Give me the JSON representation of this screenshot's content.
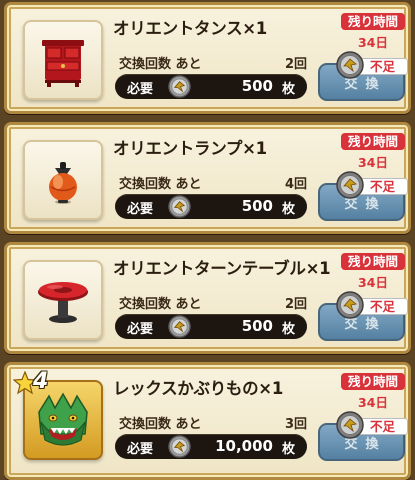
{
  "items": [
    {
      "name": "オリエントタンス×1",
      "icon": "red-cabinet-icon",
      "exchange_label": "交換回数 あと",
      "exchange_count": "2回",
      "cost_label": "必要",
      "cost_value": "500",
      "cost_unit": "枚",
      "time_label": "残り時間",
      "time_value": "34日",
      "shortage_label": "不足",
      "button_label": "交換",
      "rarity": ""
    },
    {
      "name": "オリエントランプ×1",
      "icon": "orient-lamp-icon",
      "exchange_label": "交換回数 あと",
      "exchange_count": "4回",
      "cost_label": "必要",
      "cost_value": "500",
      "cost_unit": "枚",
      "time_label": "残り時間",
      "time_value": "34日",
      "shortage_label": "不足",
      "button_label": "交換",
      "rarity": ""
    },
    {
      "name": "オリエントターンテーブル×1",
      "icon": "red-turntable-icon",
      "exchange_label": "交換回数 あと",
      "exchange_count": "2回",
      "cost_label": "必要",
      "cost_value": "500",
      "cost_unit": "枚",
      "time_label": "残り時間",
      "time_value": "34日",
      "shortage_label": "不足",
      "button_label": "交換",
      "rarity": ""
    },
    {
      "name": "レックスかぶりもの×1",
      "icon": "dragon-headgear-icon",
      "exchange_label": "交換回数 あと",
      "exchange_count": "3回",
      "cost_label": "必要",
      "cost_value": "10,000",
      "cost_unit": "枚",
      "time_label": "残り時間",
      "time_value": "34日",
      "shortage_label": "不足",
      "button_label": "交換",
      "rarity": "4"
    }
  ],
  "colors": {
    "accent_red": "#d8323a",
    "button_blue": "#4d82ae",
    "frame_gold": "#b08840",
    "cost_bar": "#1d1610"
  }
}
